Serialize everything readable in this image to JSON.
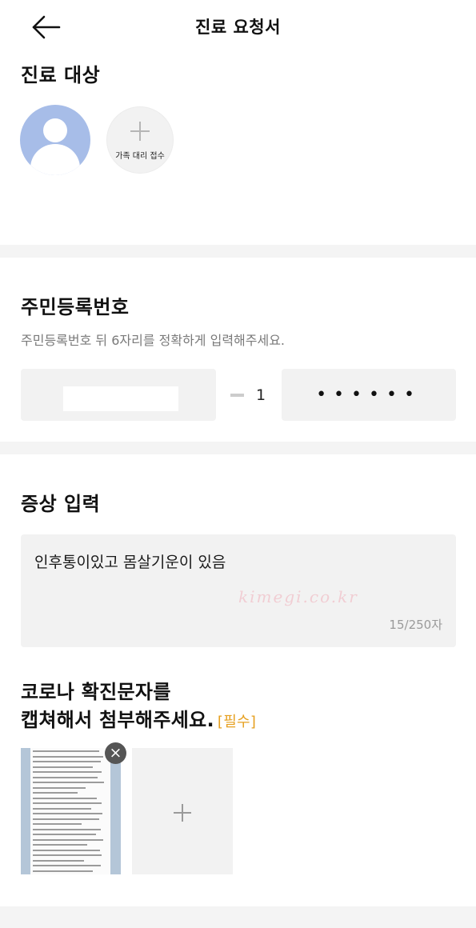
{
  "header": {
    "title": "진료 요청서",
    "back_icon": "arrow-left-icon"
  },
  "patient": {
    "section_title": "진료 대상",
    "avatar_icon": "user-avatar-icon",
    "add_family_label": "가족 대리 접수",
    "add_family_icon": "plus-icon"
  },
  "rrn": {
    "section_title": "주민등록번호",
    "helper_text": "주민등록번호 뒤 6자리를 정확하게 입력해주세요.",
    "back_first_digit": "1",
    "back_masked": "••••••"
  },
  "symptoms": {
    "section_title": "증상 입력",
    "value": "인후통이있고 몸살기운이 있음",
    "watermark": "kimegi.co.kr",
    "char_count": "15/250자"
  },
  "attachment": {
    "title_line1": "코로나 확진문자를",
    "title_line2": "캡쳐해서 첨부해주세요.",
    "required_label": "[필수]",
    "remove_icon": "close-icon",
    "add_icon": "plus-icon"
  },
  "colors": {
    "avatar_bg": "#a7bde8",
    "required_accent": "#e6a020",
    "field_bg": "#f2f2f2",
    "divider_bg": "#f4f4f4"
  }
}
